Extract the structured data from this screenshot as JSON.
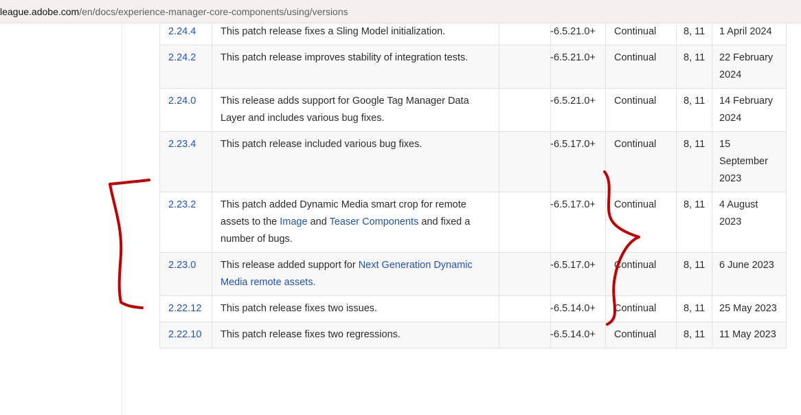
{
  "url_bar": {
    "host": "league.adobe.com",
    "path": "/en/docs/experience-manager-core-components/using/versions"
  },
  "table": {
    "rows": [
      {
        "version": "",
        "description_parts": [
          {
            "text": "initialization."
          }
        ],
        "dash": "",
        "aem": "",
        "aem_cloud": "",
        "java": "",
        "date": "2024"
      },
      {
        "version": "2.24.4",
        "description_parts": [
          {
            "text": "This patch release fixes a Sling Model initialization."
          }
        ],
        "dash": "-",
        "aem": "6.5.21.0+",
        "aem_cloud": "Continual",
        "java": "8, 11",
        "date": "1 April 2024"
      },
      {
        "version": "2.24.2",
        "description_parts": [
          {
            "text": "This patch release improves stability of integration tests."
          }
        ],
        "dash": "-",
        "aem": "6.5.21.0+",
        "aem_cloud": "Continual",
        "java": "8, 11",
        "date": "22 February 2024"
      },
      {
        "version": "2.24.0",
        "description_parts": [
          {
            "text": "This release adds support for Google Tag Manager Data Layer and includes various bug fixes."
          }
        ],
        "dash": "-",
        "aem": "6.5.21.0+",
        "aem_cloud": "Continual",
        "java": "8, 11",
        "date": "14 February 2024"
      },
      {
        "version": "2.23.4",
        "description_parts": [
          {
            "text": "This patch release included various bug fixes."
          }
        ],
        "dash": "-",
        "aem": "6.5.17.0+",
        "aem_cloud": "Continual",
        "java": "8, 11",
        "date": "15 September 2023"
      },
      {
        "version": "2.23.2",
        "description_parts": [
          {
            "text": "This patch added Dynamic Media smart crop for remote assets to the "
          },
          {
            "text": "Image",
            "link": true
          },
          {
            "text": " and "
          },
          {
            "text": "Teaser Components",
            "link": true
          },
          {
            "text": " and fixed a number of bugs."
          }
        ],
        "dash": "-",
        "aem": "6.5.17.0+",
        "aem_cloud": "Continual",
        "java": "8, 11",
        "date": "4 August 2023"
      },
      {
        "version": "2.23.0",
        "description_parts": [
          {
            "text": "This release added support for "
          },
          {
            "text": "Next Generation Dynamic Media remote assets.",
            "link": true
          }
        ],
        "dash": "-",
        "aem": "6.5.17.0+",
        "aem_cloud": "Continual",
        "java": "8, 11",
        "date": "6 June 2023"
      },
      {
        "version": "2.22.12",
        "description_parts": [
          {
            "text": "This patch release fixes two issues."
          }
        ],
        "dash": "-",
        "aem": "6.5.14.0+",
        "aem_cloud": "Continual",
        "java": "8, 11",
        "date": "25 May 2023"
      },
      {
        "version": "2.22.10",
        "description_parts": [
          {
            "text": "This patch release fixes two regressions."
          }
        ],
        "dash": "-",
        "aem": "6.5.14.0+",
        "aem_cloud": "Continual",
        "java": "8, 11",
        "date": "11 May 2023"
      }
    ]
  },
  "annotation": {
    "color": "#c40000"
  }
}
